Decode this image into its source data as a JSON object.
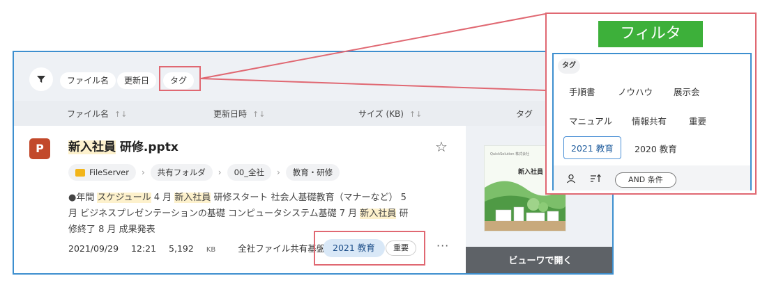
{
  "colors": {
    "accent_blue": "#3d8fcf",
    "annotation_red": "#e06872",
    "filter_green": "#3db03a",
    "ppt_red": "#c2492b"
  },
  "toolbar": {
    "filter_icon": "filter-icon",
    "chips": [
      "ファイル名",
      "更新日",
      "タグ"
    ]
  },
  "columns": {
    "file_name": "ファイル名",
    "updated": "更新日時",
    "size": "サイズ (KB)",
    "tag": "タグ",
    "sort_glyph": "↑↓"
  },
  "result": {
    "icon_letter": "P",
    "title_highlight": "新入社員",
    "title_rest": "研修.pptx",
    "path": [
      "FileServer",
      "共有フォルダ",
      "00_全社",
      "教育・研修"
    ],
    "snippet_parts": [
      {
        "t": "●年間 ",
        "hl": false
      },
      {
        "t": "スケジュール",
        "hl": true
      },
      {
        "t": " 4 月 ",
        "hl": false
      },
      {
        "t": "新入社員",
        "hl": true
      },
      {
        "t": " 研修スタート 社会人基礎教育（マナーなど） 5 月 ビジネスプレゼンテーションの基礎 コンピュータシステム基礎 7 月 ",
        "hl": false
      },
      {
        "t": "新入社員",
        "hl": true
      },
      {
        "t": " 研修終了 8 月 成果発表",
        "hl": false
      }
    ],
    "date": "2021/09/29",
    "time": "12:21",
    "size": "5,192",
    "size_unit": "KB",
    "location": "全社ファイル共有基盤",
    "tags": [
      "2021 教育",
      "重要"
    ],
    "more_label": "···"
  },
  "preview": {
    "thumb_header": "QuickSolution 株式会社",
    "thumb_title": "新入社員",
    "open_button": "ビューワで開く"
  },
  "filter_panel": {
    "title": "フィルタ",
    "section_label": "タグ",
    "tags_row1": [
      "手順書",
      "ノウハウ",
      "展示会"
    ],
    "tags_row2": [
      "マニュアル",
      "情報共有",
      "重要"
    ],
    "tags_row3_selected": "2021 教育",
    "tags_row3_other": "2020 教育",
    "and_button": "AND 条件"
  }
}
